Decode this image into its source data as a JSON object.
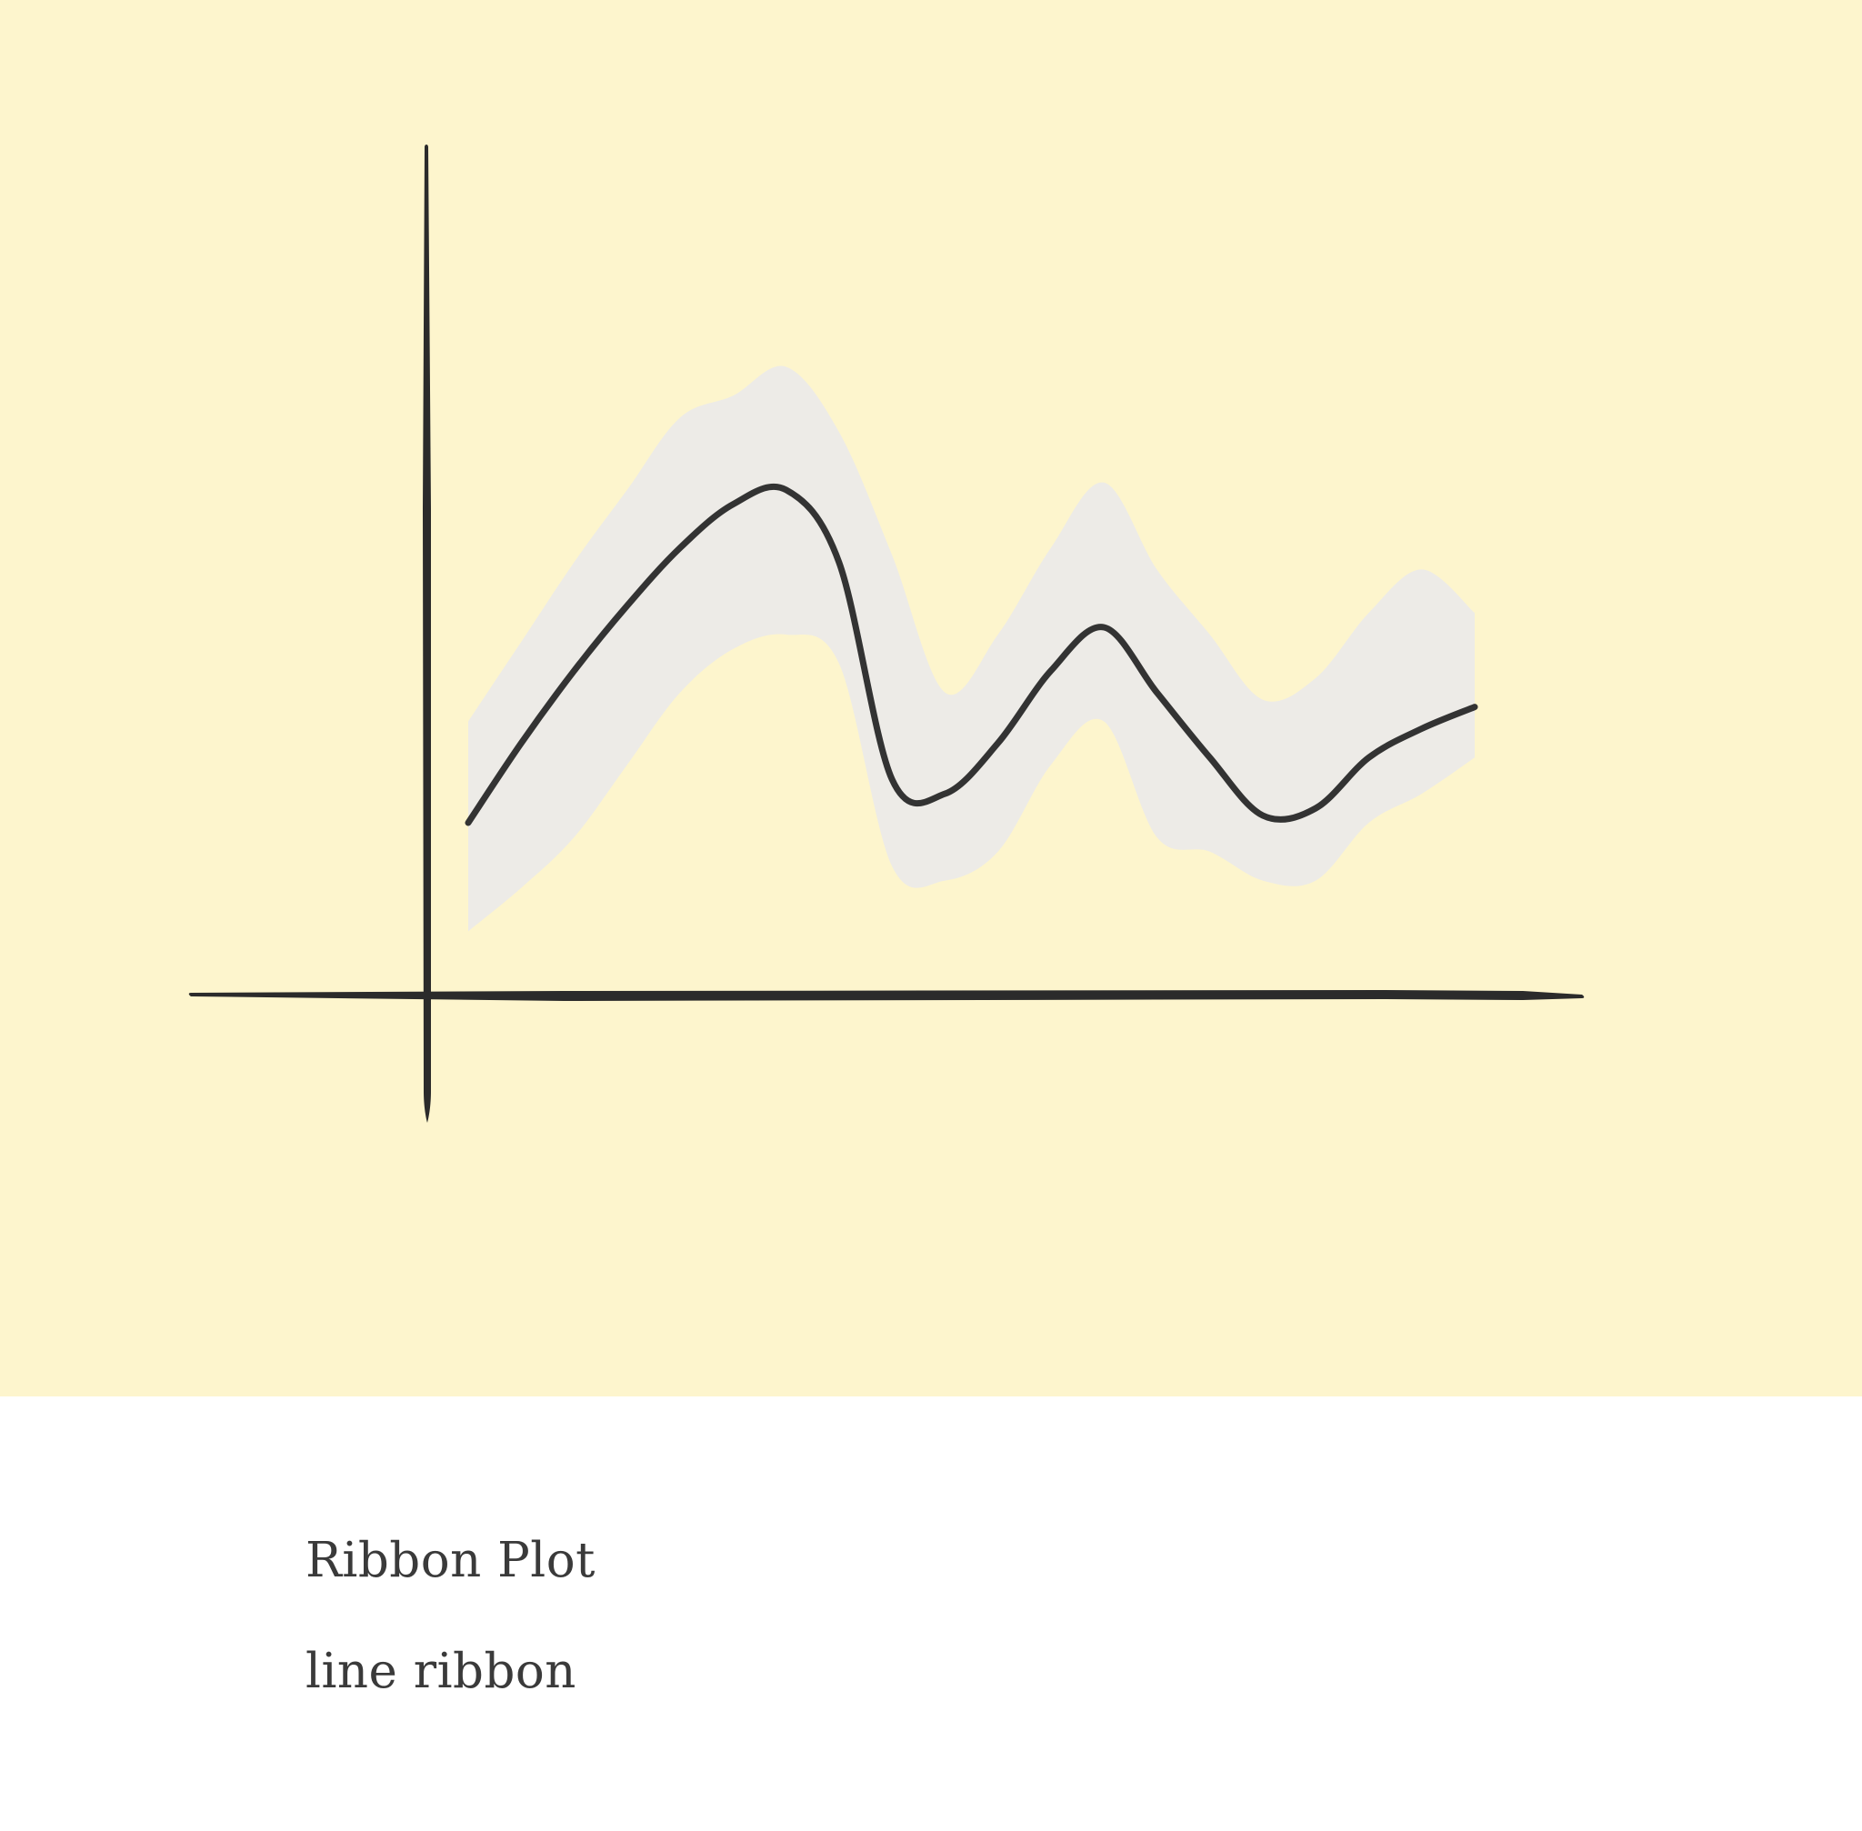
{
  "card": {
    "title": "Ribbon Plot",
    "subtitle": "line ribbon"
  },
  "colors": {
    "background": "#fdf5cd",
    "ribbon": "#edebe7",
    "line": "#333333",
    "axis": "#2b2b2b",
    "caption_background": "#ffffff",
    "caption_text": "#3a3a3a"
  },
  "chart_data": {
    "type": "area",
    "style": "hand-drawn",
    "title": "",
    "xlabel": "",
    "ylabel": "",
    "grid": false,
    "legend": "none",
    "tick_labels": false,
    "xlim": [
      0,
      100
    ],
    "ylim": [
      0,
      100
    ],
    "x": [
      5,
      10,
      15,
      20,
      25,
      30,
      35,
      40,
      45,
      50,
      55,
      60,
      65,
      70,
      75,
      80,
      85,
      90,
      95,
      100
    ],
    "series": [
      {
        "role": "line",
        "values": [
          24,
          35,
          45,
          54,
          62,
          68,
          70,
          60,
          30,
          28,
          35,
          45,
          51,
          42,
          33,
          25,
          26,
          33,
          37,
          40
        ]
      },
      {
        "role": "ribbon-lower",
        "values": [
          9,
          15,
          22,
          32,
          42,
          48,
          50,
          46,
          18,
          16,
          20,
          32,
          38,
          22,
          20,
          16,
          16,
          24,
          28,
          33
        ]
      },
      {
        "role": "ribbon-upper",
        "values": [
          38,
          49,
          60,
          70,
          80,
          83,
          87,
          78,
          61,
          42,
          50,
          62,
          71,
          59,
          50,
          41,
          44,
          53,
          59,
          53
        ]
      }
    ]
  }
}
